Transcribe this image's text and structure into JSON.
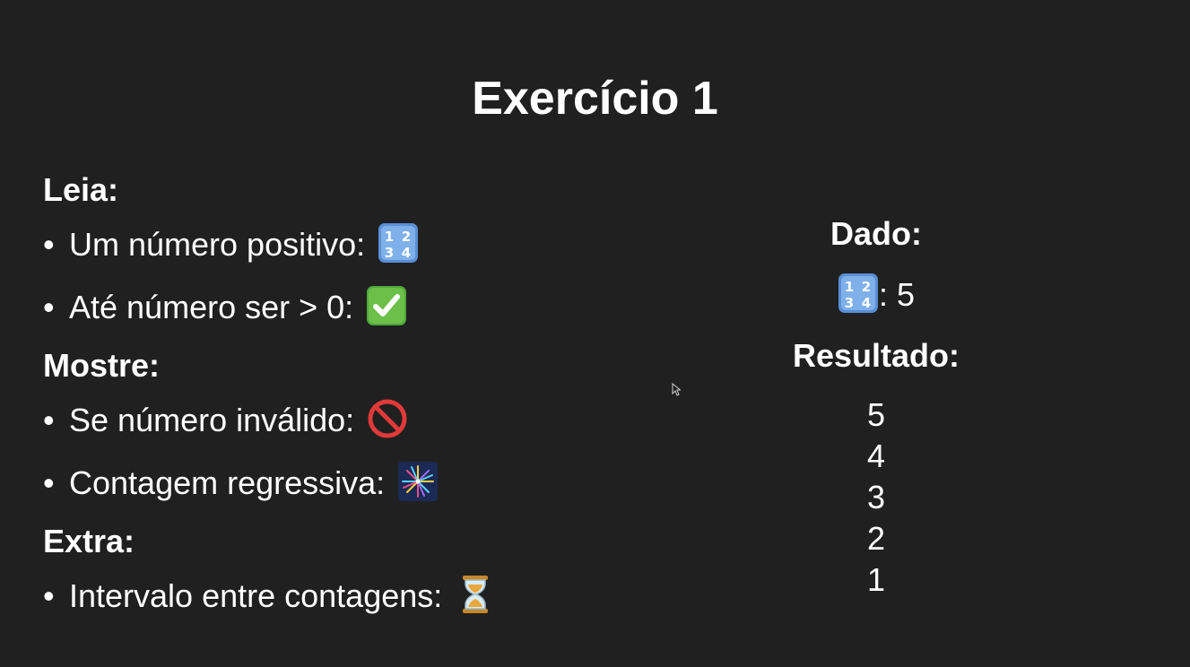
{
  "title": "Exercício 1",
  "sections": [
    {
      "heading": "Leia:",
      "items": [
        {
          "text": "Um número positivo:",
          "icon": "input-numbers-icon"
        },
        {
          "text": "Até número ser > 0:",
          "icon": "check-mark-button-icon"
        }
      ]
    },
    {
      "heading": "Mostre:",
      "items": [
        {
          "text": "Se número inválido:",
          "icon": "prohibited-icon"
        },
        {
          "text": "Contagem regressiva:",
          "icon": "fireworks-icon"
        }
      ]
    },
    {
      "heading": "Extra:",
      "items": [
        {
          "text": "Intervalo entre contagens:",
          "icon": "hourglass-icon"
        }
      ]
    }
  ],
  "bullet_char": "•",
  "example": {
    "given_heading": "Dado:",
    "given_icon": "input-numbers-icon",
    "given_value": ": 5",
    "result_heading": "Resultado:",
    "results": [
      "5",
      "4",
      "3",
      "2",
      "1"
    ]
  },
  "colors": {
    "background": "#202020",
    "text": "#ffffff",
    "keycap_blue": "#5a8fd6",
    "check_green": "#6cc04a",
    "prohibited_red": "#e03a3a",
    "hourglass_gold": "#e8a73a"
  }
}
